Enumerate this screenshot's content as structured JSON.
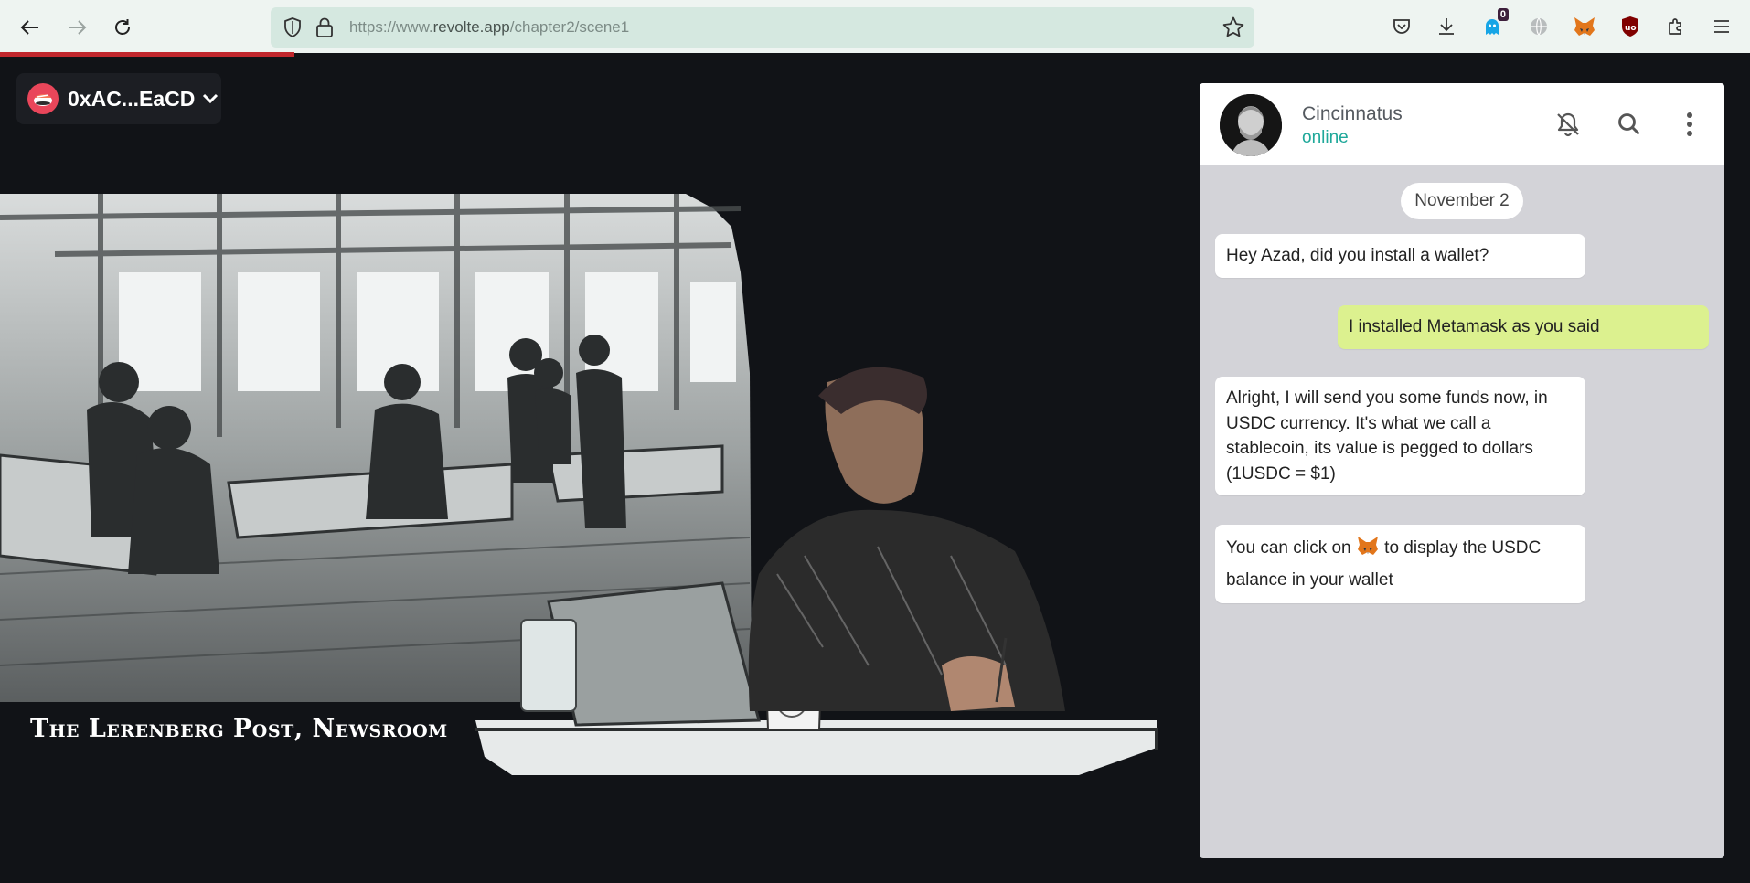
{
  "browser": {
    "url_prefix": "https://www.",
    "url_host": "revolte.app",
    "url_path": "/chapter2/scene1",
    "extension_badge": "0",
    "icons": [
      "back-arrow-icon",
      "forward-arrow-icon",
      "reload-icon",
      "shield-icon",
      "lock-icon",
      "bookmark-star-icon",
      "pocket-icon",
      "download-icon",
      "ghost-extension-icon",
      "globe-icon",
      "metamask-fox-icon",
      "ublock-icon",
      "extensions-puzzle-icon",
      "menu-hamburger-icon"
    ]
  },
  "page_progress": 0.168,
  "wallet": {
    "address": "0xAC...EaCD",
    "icons": [
      "sushi-logo-icon",
      "chevron-down-icon"
    ]
  },
  "scene": {
    "title": "The Lerenberg Post, Newsroom"
  },
  "chat": {
    "contact_name": "Cincinnatus",
    "contact_status": "online",
    "date": "November 2",
    "messages": [
      {
        "direction": "in",
        "text": "Hey Azad, did you install a wallet?"
      },
      {
        "direction": "out",
        "text": "I installed Metamask as you said"
      },
      {
        "direction": "in",
        "text": "Alright, I will send you some funds now, in USDC currency. It's what we call a stablecoin, its value is pegged to dollars (1USDC = $1)"
      },
      {
        "direction": "in",
        "text_before": "You can click on",
        "text_after": "to display the USDC balance in your wallet"
      }
    ],
    "icons": [
      "bell-off-icon",
      "search-icon",
      "more-vertical-icon"
    ]
  },
  "colors": {
    "page_bg": "#111317",
    "accent_online": "#1fa89a",
    "outgoing_bubble": "#dcf18f",
    "progress_bar": "#c1272d",
    "chat_bg": "#d3d3d8"
  }
}
